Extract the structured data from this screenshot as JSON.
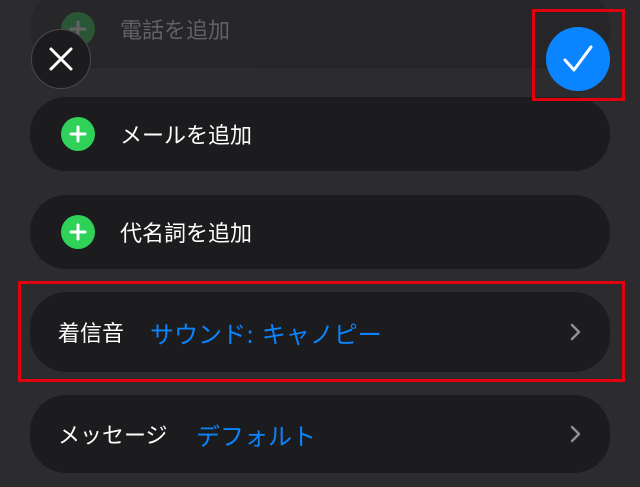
{
  "rows": {
    "add_phone": "電話を追加",
    "add_email": "メールを追加",
    "add_pronoun": "代名詞を追加",
    "ringtone": {
      "key": "着信音",
      "value": "サウンド: キャノピー"
    },
    "message": {
      "key": "メッセージ",
      "value": "デフォルト"
    }
  },
  "icons": {
    "close": "close-icon",
    "confirm": "checkmark-icon",
    "add": "plus-icon",
    "chevron": "chevron-right-icon"
  },
  "colors": {
    "accent": "#0a84ff",
    "add_green": "#30d158",
    "highlight": "#e3000f"
  }
}
